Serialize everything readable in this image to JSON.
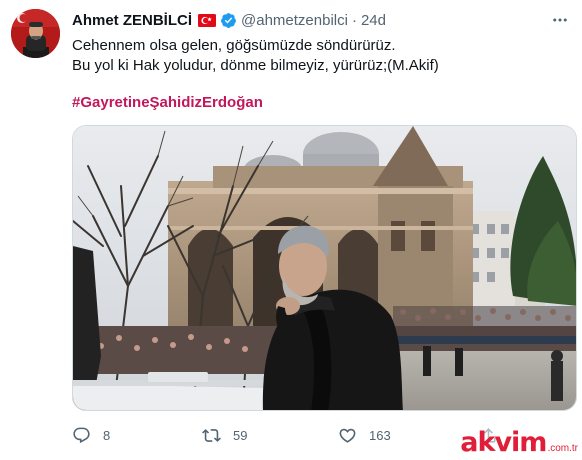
{
  "author": {
    "display_name": "Ahmet ZENBİLCİ",
    "handle": "@ahmetzenbilci",
    "separator": "·",
    "age": "24d"
  },
  "tweet": {
    "lines": [
      "Cehennem olsa gelen, göğsümüzde söndürürüz.",
      "Bu yol ki Hak yoludur, dönme bilmeyiz, yürürüz;(M.Akif)"
    ],
    "hashtag": "#GayretineŞahidizErdoğan"
  },
  "stats": {
    "replies": "8",
    "retweets": "59",
    "likes": "163"
  },
  "watermark": {
    "brand": "akvim",
    "suffix": ".com.tr"
  },
  "icons": {
    "flag": "turkey-flag-icon",
    "verified": "verified-badge-icon",
    "more": "more-dots-icon",
    "reply": "reply-icon",
    "retweet": "retweet-icon",
    "like": "heart-icon",
    "share": "share-icon"
  },
  "colors": {
    "hashtag": "#c2185b",
    "verified": "#1d9bf0",
    "muted": "#536471",
    "flag_red": "#e30a17",
    "watermark": "#e01e37"
  }
}
